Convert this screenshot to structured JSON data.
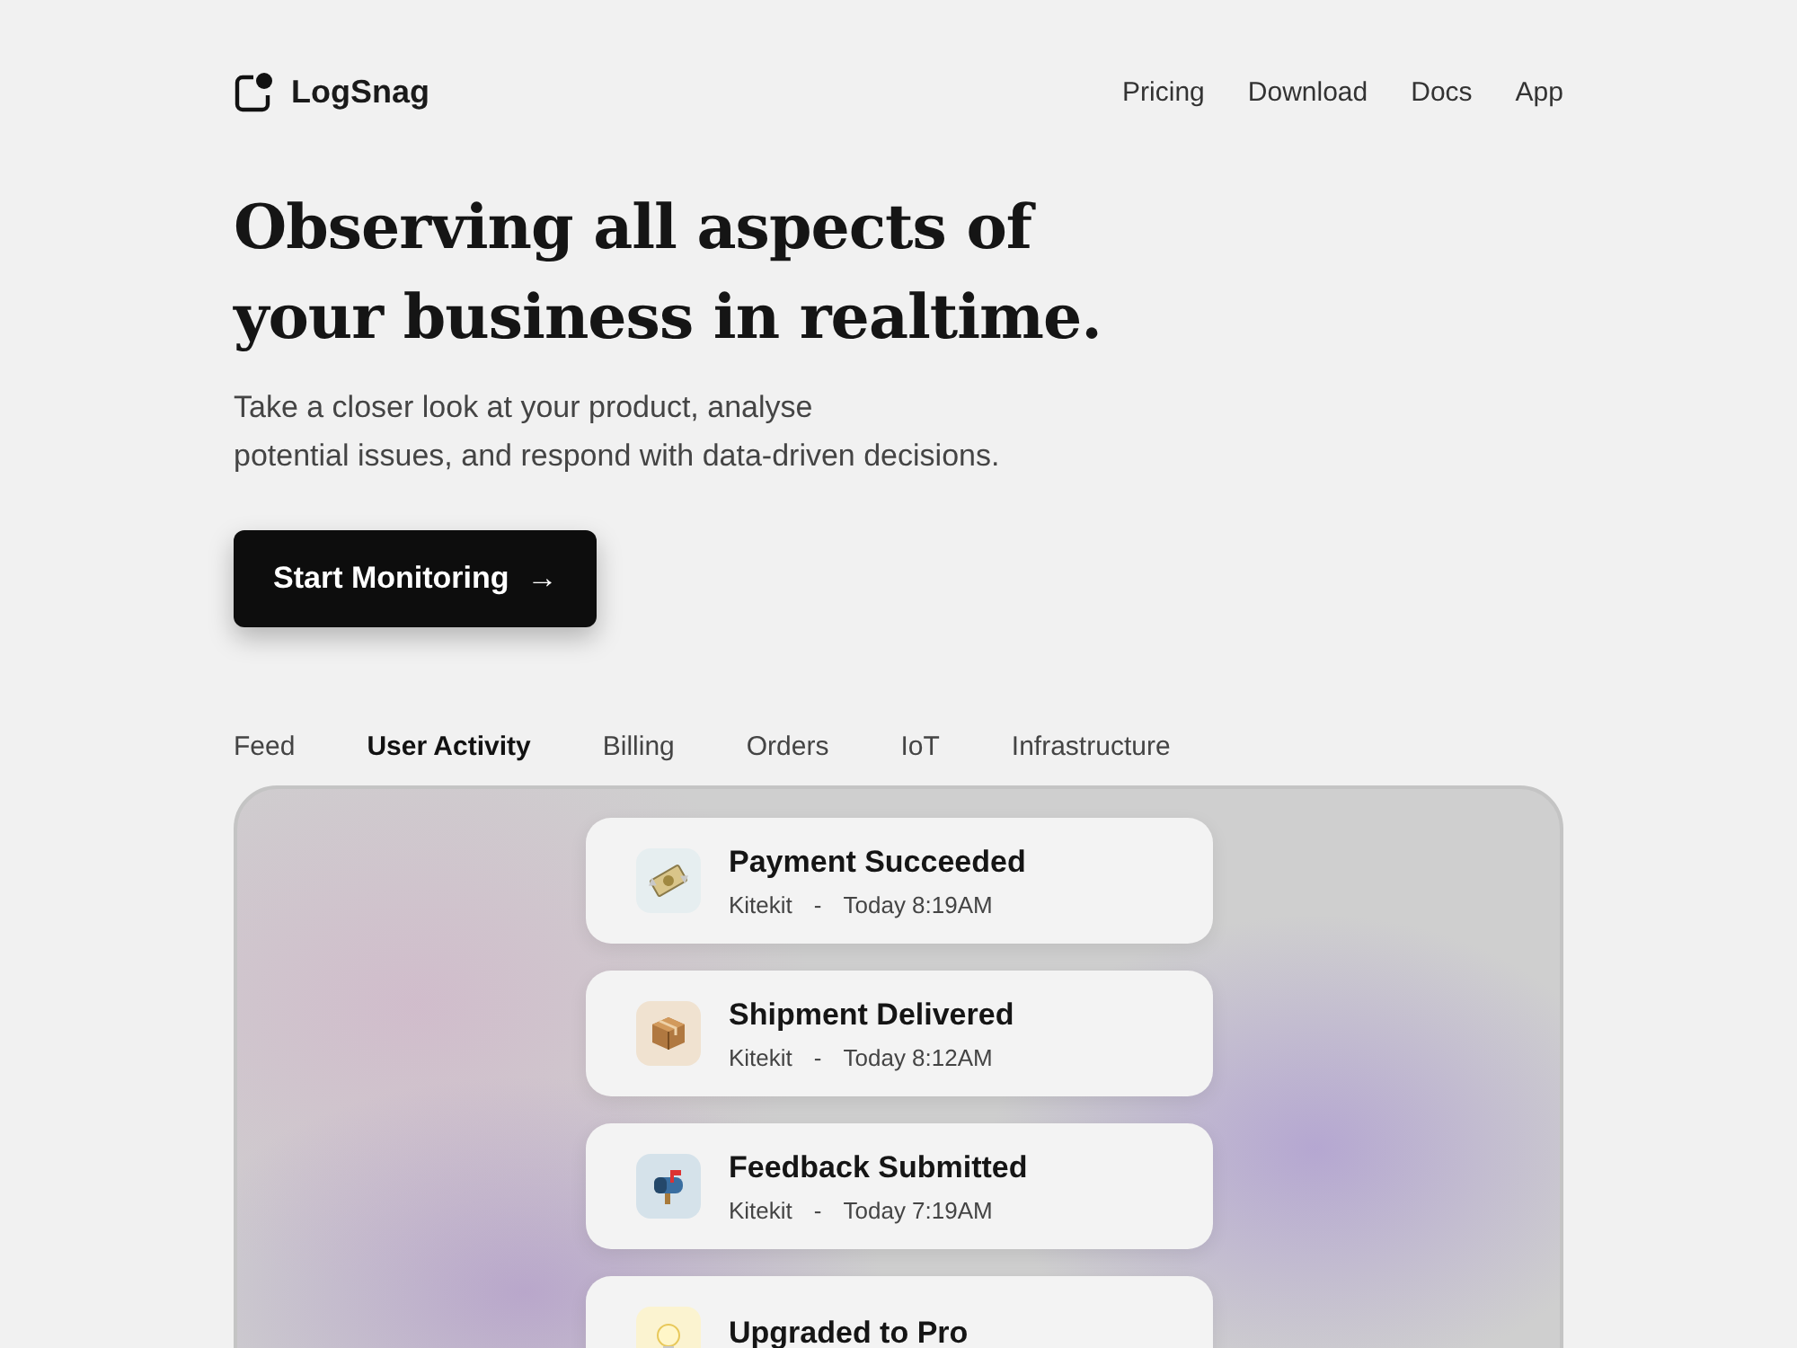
{
  "brand": {
    "name": "LogSnag"
  },
  "nav": [
    "Pricing",
    "Download",
    "Docs",
    "App"
  ],
  "hero": {
    "title_lines": [
      "Observing all aspects of",
      "your business in realtime."
    ],
    "subtitle_lines": [
      "Take a closer look at your product, analyse",
      "potential issues, and respond with data-driven decisions."
    ],
    "cta": {
      "label": "Start Monitoring",
      "arrow": "→"
    }
  },
  "tabs": [
    {
      "label": "Feed",
      "selected": false
    },
    {
      "label": "User Activity",
      "selected": true
    },
    {
      "label": "Billing",
      "selected": false
    },
    {
      "label": "Orders",
      "selected": false
    },
    {
      "label": "IoT",
      "selected": false
    },
    {
      "label": "Infrastructure",
      "selected": false
    }
  ],
  "events": [
    {
      "kind": "money",
      "title": "Payment Succeeded",
      "project": "Kitekit",
      "separator": "-",
      "time": "Today 8:19AM"
    },
    {
      "kind": "package",
      "title": "Shipment Delivered",
      "project": "Kitekit",
      "separator": "-",
      "time": "Today 8:12AM"
    },
    {
      "kind": "mailbox",
      "title": "Feedback Submitted",
      "project": "Kitekit",
      "separator": "-",
      "time": "Today 7:19AM"
    },
    {
      "kind": "bulb",
      "title": "Upgraded to Pro"
    }
  ]
}
